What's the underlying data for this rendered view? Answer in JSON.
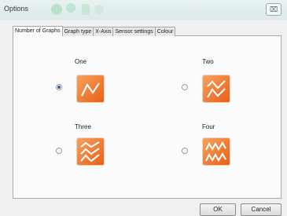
{
  "window": {
    "title": "Options",
    "close_glyph": "⌧"
  },
  "tabs": [
    {
      "label": "Number of Graphs",
      "active": true
    },
    {
      "label": "Graph type",
      "active": false
    },
    {
      "label": "X-Axis",
      "active": false
    },
    {
      "label": "Sensor settings",
      "active": false
    },
    {
      "label": "Colour",
      "active": false
    }
  ],
  "options": [
    {
      "label": "One",
      "selected": true,
      "icon": "single-graph-icon"
    },
    {
      "label": "Two",
      "selected": false,
      "icon": "two-graphs-icon"
    },
    {
      "label": "Three",
      "selected": false,
      "icon": "three-graphs-icon"
    },
    {
      "label": "Four",
      "selected": false,
      "icon": "four-graphs-icon"
    }
  ],
  "buttons": {
    "ok": "OK",
    "cancel": "Cancel"
  },
  "colors": {
    "icon_start": "#f6a25c",
    "icon_end": "#e8601a",
    "radio_dot": "#3c5f9a"
  }
}
